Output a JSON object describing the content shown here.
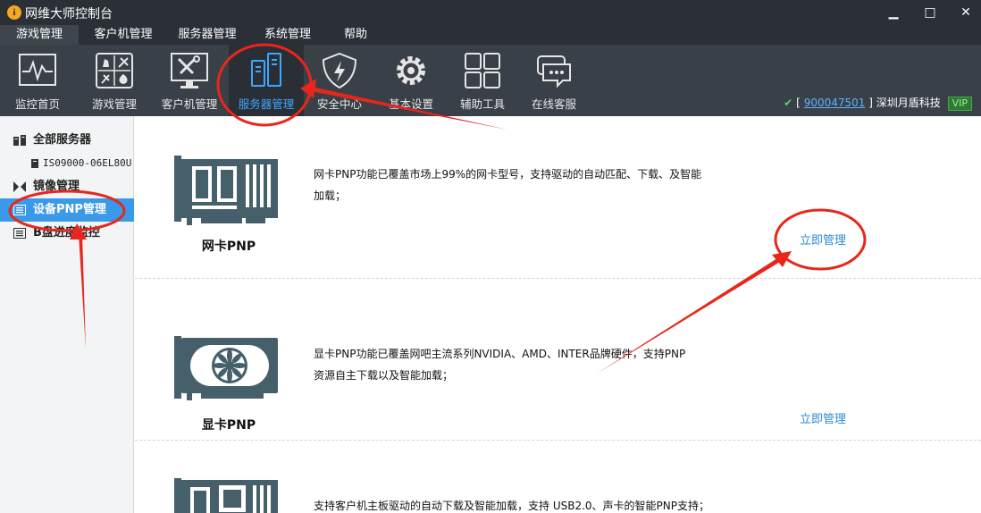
{
  "window": {
    "title": "网维大师控制台",
    "app_icon": "i",
    "minimize": "▁",
    "maximize": "□",
    "close": "✕"
  },
  "menu": [
    "游戏管理",
    "客户机管理",
    "服务器管理",
    "系统管理",
    "帮助"
  ],
  "toolbar": {
    "items": [
      {
        "label": "监控首页",
        "icon": "monitor-chart-icon"
      },
      {
        "label": "游戏管理",
        "icon": "game-chess-icon"
      },
      {
        "label": "客户机管理",
        "icon": "client-tools-icon"
      },
      {
        "label": "服务器管理",
        "icon": "server-icon"
      },
      {
        "label": "安全中心",
        "icon": "shield-bolt-icon"
      },
      {
        "label": "基本设置",
        "icon": "gear-icon"
      },
      {
        "label": "辅助工具",
        "icon": "grid-icon"
      },
      {
        "label": "在线客服",
        "icon": "chat-icon"
      }
    ],
    "active_index": 3
  },
  "status": {
    "check": "✔",
    "open_bracket": "[",
    "user_id": "900047501",
    "close_bracket": "]",
    "company": "深圳月盾科技",
    "vip": "VIP"
  },
  "sidebar": {
    "items": [
      {
        "label": "全部服务器",
        "icon": "server-icon"
      },
      {
        "label": "IS09000-06EL80U（",
        "icon": "server-small-icon"
      },
      {
        "label": "镜像管理",
        "icon": "mirror-icon"
      },
      {
        "label": "设备PNP管理",
        "icon": "device-list-icon"
      },
      {
        "label": "B盘进度监控",
        "icon": "device-list-icon"
      }
    ],
    "active_index": 3
  },
  "cards": [
    {
      "name": "网卡PNP",
      "desc_line1": "网卡PNP功能已覆盖市场上99%的网卡型号，支持驱动的自动匹配、下载、及智能加载；",
      "desc_line2": "",
      "link": "立即管理",
      "icon": "network-card-icon"
    },
    {
      "name": "显卡PNP",
      "desc_line1": "显卡PNP功能已覆盖网吧主流系列NVIDIA、AMD、INTER品牌硬件，支持PNP",
      "desc_line2": "资源自主下载以及智能加载；",
      "link": "立即管理",
      "icon": "graphics-card-icon"
    },
    {
      "name": "",
      "desc_line1": "支持客户机主板驱动的自动下载及智能加载，支持 USB2.0、声卡的智能PNP支持；",
      "desc_line2": "",
      "link": "",
      "icon": "motherboard-icon"
    }
  ],
  "colors": {
    "titlebar": "#2b3036",
    "toolbar": "#3a4047",
    "active_blue": "#3a99e8",
    "link_blue": "#2a8bd8",
    "illustration": "#45606a",
    "annotation_red": "#e8261c"
  }
}
